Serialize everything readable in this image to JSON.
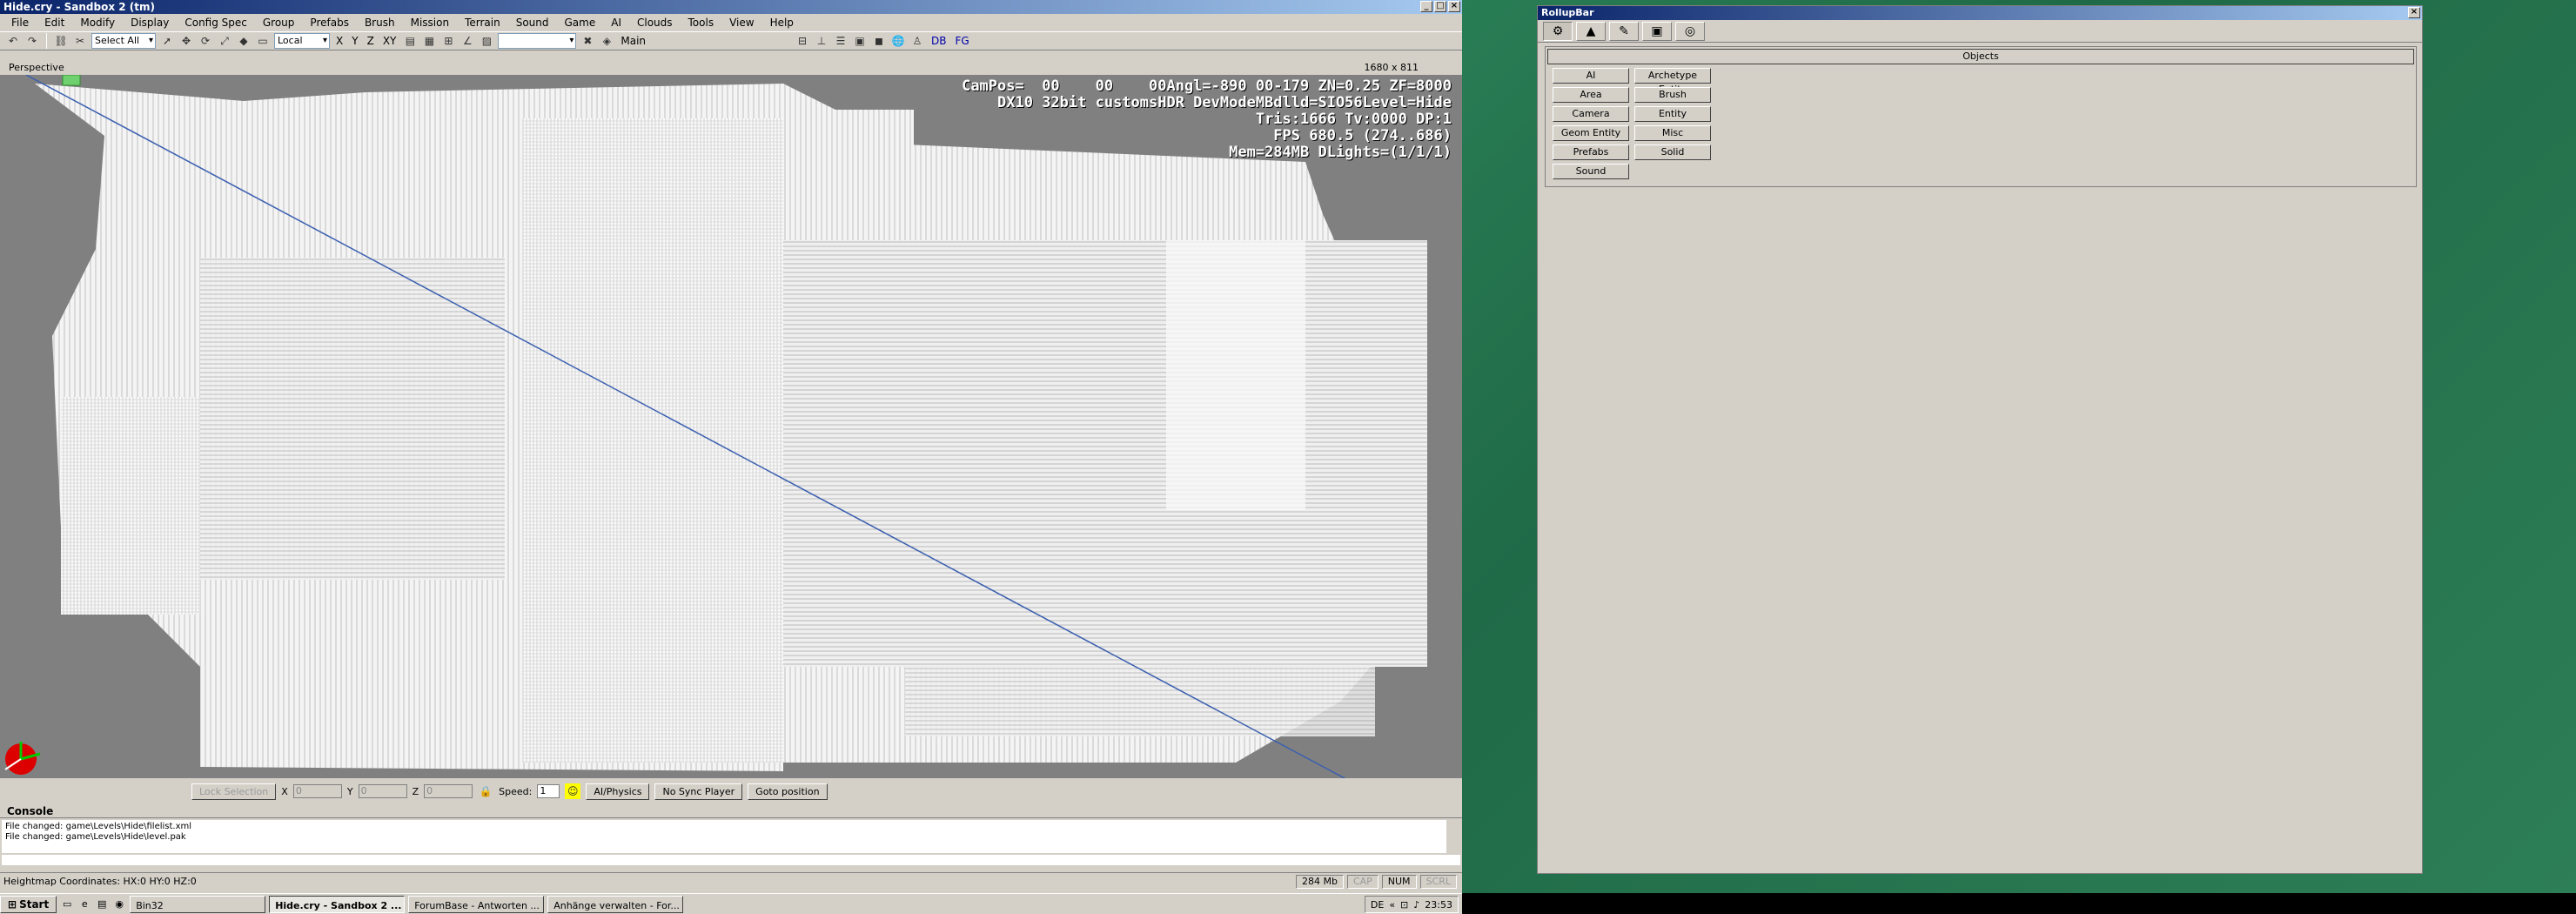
{
  "editor": {
    "title": "Hide.cry - Sandbox 2 (tm)",
    "menu": [
      "File",
      "Edit",
      "Modify",
      "Display",
      "Config Spec",
      "Group",
      "Prefabs",
      "Brush",
      "Mission",
      "Terrain",
      "Sound",
      "Game",
      "AI",
      "Clouds",
      "Tools",
      "View",
      "Help"
    ],
    "toolbar": {
      "selection_filter": "Select All",
      "coord_system": "Local",
      "axes": [
        "X",
        "Y",
        "Z",
        "XY"
      ],
      "layer": "Main",
      "db_label": "DB",
      "fg_label": "FG"
    },
    "viewport": {
      "label": "Perspective",
      "size": "1680 x 811",
      "hud_lines": [
        "CamPos=  00    00    00Angl=-890 00-179 ZN=0.25 ZF=8000",
        "DX10 32bit customsHDR DevModeMBdlld=SIO56Level=Hide",
        "Tris:1666 Tv:0000 DP:1",
        "FPS 680.5 (274..686)",
        "Mem=284MB DLights=(1/1/1)"
      ]
    },
    "view_controls": {
      "lock_selection": "Lock Selection",
      "x_label": "X",
      "y_label": "Y",
      "z_label": "Z",
      "x_value": "0",
      "y_value": "0",
      "z_value": "0",
      "speed_label": "Speed:",
      "speed_value": "1",
      "ai_physics": "AI/Physics",
      "no_sync_player": "No Sync Player",
      "goto_position": "Goto position"
    },
    "console": {
      "title": "Console",
      "lines": [
        "File changed: game\\Levels\\Hide\\filelist.xml",
        "File changed: game\\Levels\\Hide\\level.pak"
      ]
    },
    "statusbar": {
      "text": "Heightmap Coordinates: HX:0 HY:0 HZ:0",
      "memory": "284 Mb",
      "cap": "CAP",
      "num": "NUM",
      "scrl": "SCRL"
    }
  },
  "rollup": {
    "title": "RollupBar",
    "panel_title": "Objects",
    "buttons": [
      "AI",
      "Archetype Entity",
      "Area",
      "Brush",
      "Camera",
      "Entity",
      "Geom Entity",
      "Misc",
      "Prefabs",
      "Solid",
      "Sound"
    ]
  },
  "taskbar": {
    "start": "Start",
    "tasks": [
      "Bin32",
      "Hide.cry - Sandbox 2 ...",
      "ForumBase - Antworten ...",
      "Anhänge verwalten - For..."
    ],
    "lang": "DE",
    "clock": "23:53"
  }
}
